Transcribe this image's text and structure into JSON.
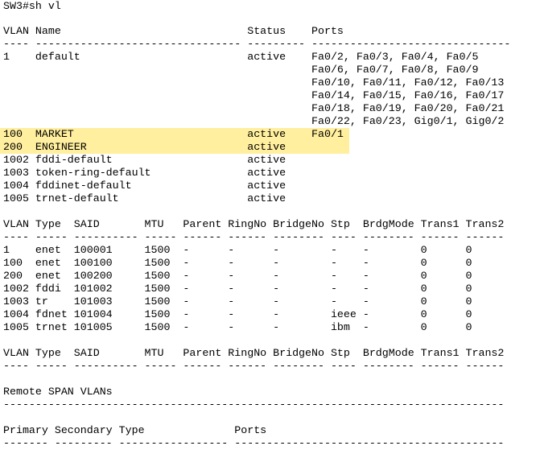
{
  "terminal": {
    "prompt": "SW3#sh vl",
    "highlight_color": "#ffef9e",
    "lines": [
      {
        "id": "l-hdr1",
        "text": "VLAN Name                             Status    Ports"
      },
      {
        "id": "l-sep1",
        "text": "---- -------------------------------- --------- -------------------------------"
      },
      {
        "id": "l-v1a",
        "text": "1    default                          active    Fa0/2, Fa0/3, Fa0/4, Fa0/5"
      },
      {
        "id": "l-v1b",
        "text": "                                                Fa0/6, Fa0/7, Fa0/8, Fa0/9"
      },
      {
        "id": "l-v1c",
        "text": "                                                Fa0/10, Fa0/11, Fa0/12, Fa0/13"
      },
      {
        "id": "l-v1d",
        "text": "                                                Fa0/14, Fa0/15, Fa0/16, Fa0/17"
      },
      {
        "id": "l-v1e",
        "text": "                                                Fa0/18, Fa0/19, Fa0/20, Fa0/21"
      },
      {
        "id": "l-v1f",
        "text": "                                                Fa0/22, Fa0/23, Gig0/1, Gig0/2"
      },
      {
        "id": "l-v100",
        "text": "100  MARKET                           active    Fa0/1"
      },
      {
        "id": "l-v200",
        "text": "200  ENGINEER                         active"
      },
      {
        "id": "l-v1002",
        "text": "1002 fddi-default                     active"
      },
      {
        "id": "l-v1003",
        "text": "1003 token-ring-default               active"
      },
      {
        "id": "l-v1004",
        "text": "1004 fddinet-default                  active"
      },
      {
        "id": "l-v1005",
        "text": "1005 trnet-default                    active"
      },
      {
        "id": "l-blank1",
        "text": ""
      },
      {
        "id": "l-hdr2",
        "text": "VLAN Type  SAID       MTU   Parent RingNo BridgeNo Stp  BrdgMode Trans1 Trans2"
      },
      {
        "id": "l-sep2",
        "text": "---- ----- ---------- ----- ------ ------ -------- ---- -------- ------ ------"
      },
      {
        "id": "l-r1",
        "text": "1    enet  100001     1500  -      -      -        -    -        0      0"
      },
      {
        "id": "l-r100",
        "text": "100  enet  100100     1500  -      -      -        -    -        0      0"
      },
      {
        "id": "l-r200",
        "text": "200  enet  100200     1500  -      -      -        -    -        0      0"
      },
      {
        "id": "l-r1002",
        "text": "1002 fddi  101002     1500  -      -      -        -    -        0      0"
      },
      {
        "id": "l-r1003",
        "text": "1003 tr    101003     1500  -      -      -        -    -        0      0"
      },
      {
        "id": "l-r1004",
        "text": "1004 fdnet 101004     1500  -      -      -        ieee -        0      0"
      },
      {
        "id": "l-r1005",
        "text": "1005 trnet 101005     1500  -      -      -        ibm  -        0      0"
      },
      {
        "id": "l-blank2",
        "text": ""
      },
      {
        "id": "l-hdr3",
        "text": "VLAN Type  SAID       MTU   Parent RingNo BridgeNo Stp  BrdgMode Trans1 Trans2"
      },
      {
        "id": "l-sep3",
        "text": "---- ----- ---------- ----- ------ ------ -------- ---- -------- ------ ------"
      },
      {
        "id": "l-blank3",
        "text": ""
      },
      {
        "id": "l-rspan",
        "text": "Remote SPAN VLANs"
      },
      {
        "id": "l-sep4",
        "text": "------------------------------------------------------------------------------"
      },
      {
        "id": "l-blank4",
        "text": ""
      },
      {
        "id": "l-hdr4",
        "text": "Primary Secondary Type              Ports"
      },
      {
        "id": "l-sep5",
        "text": "------- --------- ----------------- ------------------------------------------"
      }
    ]
  }
}
